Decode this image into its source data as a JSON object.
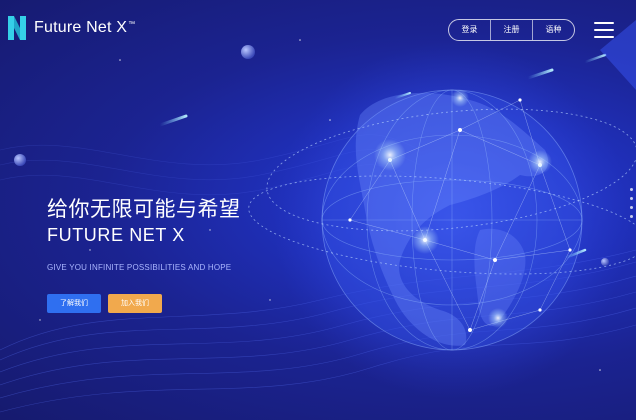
{
  "brand": {
    "name": "Future Net X",
    "trademark": "™"
  },
  "nav": {
    "items": [
      "登录",
      "注册",
      "语种"
    ]
  },
  "hero": {
    "headline": "给你无限可能与希望",
    "subheadline": "FUTURE NET X",
    "tagline": "GIVE YOU INFINITE POSSIBILITIES AND HOPE",
    "primary_button": "了解我们",
    "secondary_button": "加入我们"
  },
  "colors": {
    "background": "#1b2391",
    "primary_button": "#2f6ff0",
    "secondary_button": "#f1a94d",
    "logo_accent": "#35d0e8"
  },
  "icons": {
    "logo": "fnx-logo-icon",
    "menu": "hamburger-menu-icon"
  }
}
